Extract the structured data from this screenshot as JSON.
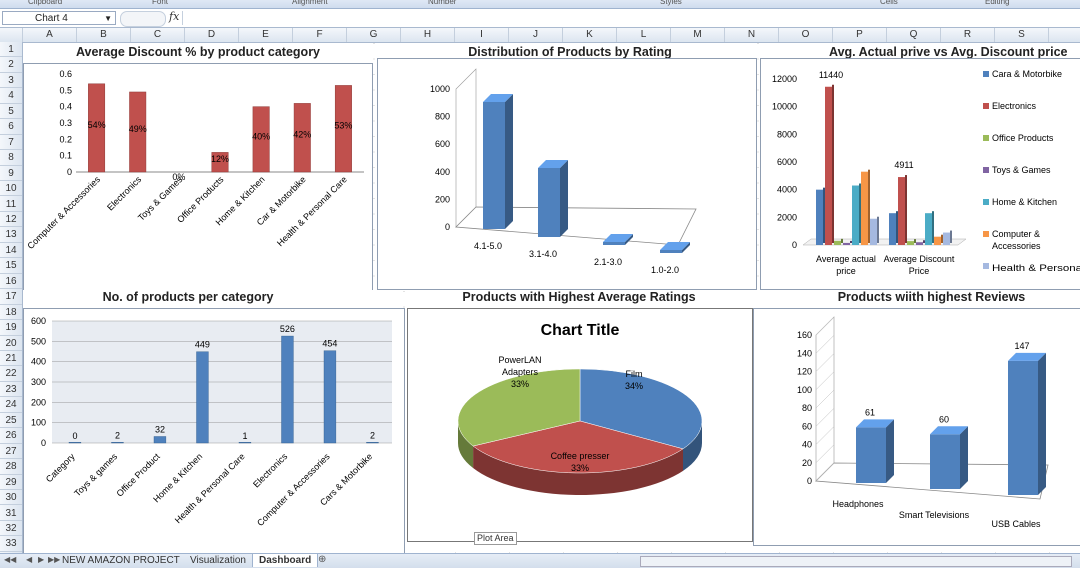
{
  "ribbon": {
    "groups": [
      "Clipboard",
      "Font",
      "Alignment",
      "Number",
      "Styles",
      "Cells",
      "Editing"
    ]
  },
  "formula_bar": {
    "name_box": "Chart 4",
    "fx": "fx"
  },
  "columns": [
    "A",
    "B",
    "C",
    "D",
    "E",
    "F",
    "G",
    "H",
    "I",
    "J",
    "K",
    "L",
    "M",
    "N",
    "O",
    "P",
    "Q",
    "R",
    "S"
  ],
  "rows": [
    "1",
    "2",
    "3",
    "4",
    "5",
    "6",
    "7",
    "8",
    "9",
    "10",
    "11",
    "12",
    "13",
    "14",
    "15",
    "16",
    "17",
    "18",
    "19",
    "20",
    "21",
    "22",
    "23",
    "24",
    "25",
    "26",
    "27",
    "28",
    "29",
    "30",
    "31",
    "32",
    "33"
  ],
  "tooltip": "Plot Area",
  "sheet_tabs": [
    {
      "label": "NEW AMAZON PROJECT",
      "active": false
    },
    {
      "label": "Visualization",
      "active": false
    },
    {
      "label": "Dashboard",
      "active": true
    }
  ],
  "chart_data": [
    {
      "type": "bar",
      "title": "Average Discount % by product category",
      "categories": [
        "Computer & Accessories",
        "Electronics",
        "Toys & Games",
        "Office Products",
        "Home & Kitchen",
        "Car & Motorbike",
        "Health & Personal Care"
      ],
      "values": [
        0.54,
        0.49,
        0,
        0.12,
        0.4,
        0.42,
        0.53
      ],
      "data_labels": [
        "54%",
        "49%",
        "0%",
        "12%",
        "40%",
        "42%",
        "53%"
      ],
      "yticks": [
        "0",
        "0.1",
        "0.2",
        "0.3",
        "0.4",
        "0.5",
        "0.6"
      ],
      "ylim": [
        0,
        0.6
      ],
      "color": "#c0504d"
    },
    {
      "type": "bar",
      "title": "Distribution of Products by Rating",
      "categories": [
        "4.1-5.0",
        "3.1-4.0",
        "2.1-3.0",
        "1.0-2.0"
      ],
      "values": [
        920,
        500,
        15,
        10
      ],
      "yticks": [
        "0",
        "200",
        "400",
        "600",
        "800",
        "1000"
      ],
      "ylim": [
        0,
        1000
      ],
      "color": "#4f81bd"
    },
    {
      "type": "bar",
      "title": "Avg. Actual prive vs Avg. Discount price",
      "categories": [
        "Average actual price",
        "Average Discount Price"
      ],
      "series": [
        {
          "name": "Cara & Motorbike",
          "values": [
            4000,
            2300
          ],
          "color": "#4f81bd"
        },
        {
          "name": "Electronics",
          "values": [
            11440,
            4911
          ],
          "color": "#c0504d"
        },
        {
          "name": "Office Products",
          "values": [
            300,
            280
          ],
          "color": "#9bbb59"
        },
        {
          "name": "Toys & Games",
          "values": [
            150,
            200
          ],
          "color": "#8064a2"
        },
        {
          "name": "Home & Kitchen",
          "values": [
            4300,
            2300
          ],
          "color": "#4bacc6"
        },
        {
          "name": "Computer & Accessories",
          "values": [
            5300,
            600
          ],
          "color": "#f79646"
        },
        {
          "name": "Health & Personal Care",
          "values": [
            1900,
            900
          ],
          "color": "#a5b9e0"
        }
      ],
      "data_labels": [
        "11440",
        "4911"
      ],
      "yticks": [
        "0",
        "2000",
        "4000",
        "6000",
        "8000",
        "10000",
        "12000"
      ],
      "ylim": [
        0,
        12000
      ],
      "legend": "right"
    },
    {
      "type": "bar",
      "title": "No. of products per category",
      "categories": [
        "Category",
        "Toys & games",
        "Office Product",
        "Home & Kitchen",
        "Health & Personal Care",
        "Electronics",
        "Computer & Accessories",
        "Cars & Motorbike"
      ],
      "values": [
        0,
        2,
        32,
        449,
        1,
        526,
        454,
        2
      ],
      "yticks": [
        "0",
        "100",
        "200",
        "300",
        "400",
        "500",
        "600"
      ],
      "ylim": [
        0,
        600
      ],
      "color": "#4f81bd"
    },
    {
      "type": "pie",
      "title": "Chart Title",
      "section_title": "Products with Highest Average Ratings",
      "slices": [
        {
          "label": "Film",
          "pct": "34%",
          "value": 34,
          "color": "#4f81bd"
        },
        {
          "label": "Coffee presser",
          "pct": "33%",
          "value": 33,
          "color": "#c0504d"
        },
        {
          "label": "PowerLAN Adapters",
          "pct": "33%",
          "value": 33,
          "color": "#9bbb59"
        }
      ]
    },
    {
      "type": "bar",
      "title": "Products wiith highest Reviews",
      "categories": [
        "Headphones",
        "Smart Televisions",
        "USB Cables"
      ],
      "values": [
        61,
        60,
        147
      ],
      "yticks": [
        "0",
        "20",
        "40",
        "60",
        "80",
        "100",
        "120",
        "140",
        "160"
      ],
      "ylim": [
        0,
        160
      ],
      "color": "#4f81bd"
    }
  ]
}
